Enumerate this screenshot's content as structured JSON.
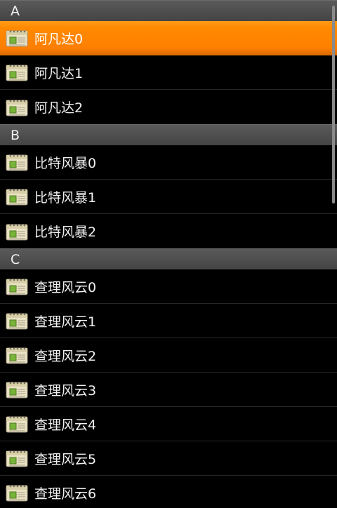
{
  "sections": [
    {
      "header": "A",
      "items": [
        "阿凡达0",
        "阿凡达1",
        "阿凡达2"
      ]
    },
    {
      "header": "B",
      "items": [
        "比特风暴0",
        "比特风暴1",
        "比特风暴2"
      ]
    },
    {
      "header": "C",
      "items": [
        "查理风云0",
        "查理风云1",
        "查理风云2",
        "查理风云3",
        "查理风云4",
        "查理风云5",
        "查理风云6"
      ]
    }
  ],
  "selected_item": "阿凡达0",
  "item_icon": "calendar-app-icon",
  "colors": {
    "background": "#000000",
    "header": "#4a4a4a",
    "selected": "#ff8a00",
    "text": "#f0f0f0"
  }
}
